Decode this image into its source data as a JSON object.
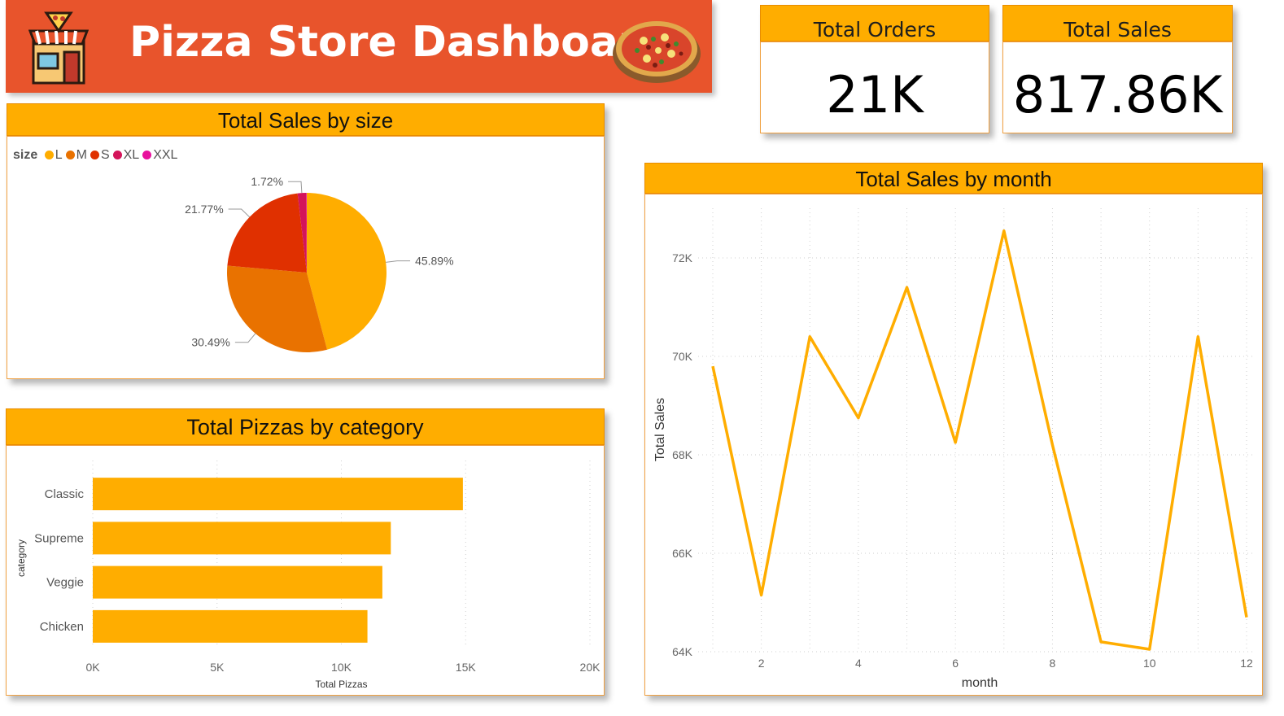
{
  "banner": {
    "title": "Pizza Store Dashboard"
  },
  "kpis": [
    {
      "label": "Total Orders",
      "value": "21K"
    },
    {
      "label": "Total Sales",
      "value": "817.86K"
    }
  ],
  "colors": {
    "orange": "#ffad00",
    "banner": "#e8542c",
    "L": "#ffad00",
    "M": "#e97200",
    "S": "#e03000",
    "XL": "#d4145a",
    "XXL": "#e8109c"
  },
  "chart_data": [
    {
      "type": "pie",
      "title": "Total Sales by size",
      "legend_title": "size",
      "legend_position": "top-left",
      "categories": [
        "L",
        "M",
        "S",
        "XL",
        "XXL"
      ],
      "values": [
        45.89,
        30.49,
        21.77,
        1.72,
        0.13
      ],
      "labels": [
        "45.89%",
        "30.49%",
        "21.77%",
        "1.72%",
        ""
      ]
    },
    {
      "type": "bar",
      "title": "Total Pizzas by category",
      "xlabel": "Total Pizzas",
      "ylabel": "category",
      "categories": [
        "Classic",
        "Supreme",
        "Veggie",
        "Chicken"
      ],
      "values": [
        14890,
        11990,
        11650,
        11050
      ],
      "xlim": [
        0,
        20000
      ],
      "xticks": [
        "0K",
        "5K",
        "10K",
        "15K",
        "20K"
      ],
      "grid": true
    },
    {
      "type": "line",
      "title": "Total Sales by month",
      "xlabel": "month",
      "ylabel": "Total Sales",
      "x": [
        1,
        2,
        3,
        4,
        5,
        6,
        7,
        8,
        9,
        10,
        11,
        12
      ],
      "y": [
        69800,
        65150,
        70400,
        68750,
        71400,
        68250,
        72550,
        68200,
        64200,
        64050,
        70400,
        64700
      ],
      "ylim": [
        64000,
        73000
      ],
      "yticks": [
        "64K",
        "66K",
        "68K",
        "70K",
        "72K"
      ],
      "xticks": [
        "2",
        "4",
        "6",
        "8",
        "10",
        "12"
      ],
      "grid": true
    }
  ]
}
